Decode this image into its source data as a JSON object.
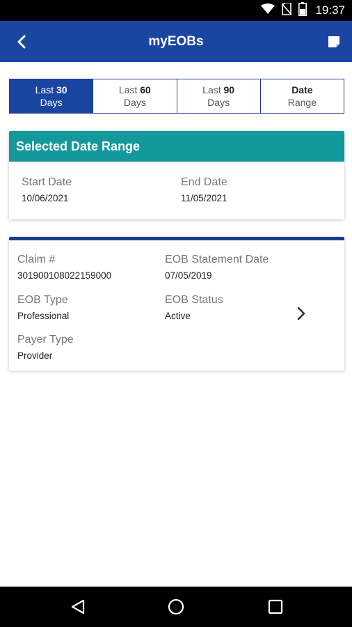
{
  "status_bar": {
    "time": "19:37",
    "icons": [
      "wifi-icon",
      "no-sim-icon",
      "battery-icon"
    ]
  },
  "app_bar": {
    "title": "myEOBs",
    "back_icon": "chevron-left-icon",
    "action_icon": "note-icon"
  },
  "date_tabs": [
    {
      "line1_prefix": "Last ",
      "line1_num": "30",
      "line2": "Days",
      "active": true
    },
    {
      "line1_prefix": "Last ",
      "line1_num": "60",
      "line2": "Days",
      "active": false
    },
    {
      "line1_prefix": "Last ",
      "line1_num": "90",
      "line2": "Days",
      "active": false
    },
    {
      "line1_prefix": "",
      "line1_num": "Date",
      "line2": "Range",
      "active": false
    }
  ],
  "selected_range": {
    "header": "Selected Date Range",
    "start_label": "Start Date",
    "start_value": "10/06/2021",
    "end_label": "End Date",
    "end_value": "11/05/2021"
  },
  "claim": {
    "claim_label": "Claim #",
    "claim_value": "301900108022159000",
    "statement_label": "EOB Statement Date",
    "statement_value": "07/05/2019",
    "type_label": "EOB Type",
    "type_value": "Professional",
    "status_label": "EOB Status",
    "status_value": "Active",
    "payer_label": "Payer Type",
    "payer_value": "Provider"
  },
  "nav": {
    "back_icon": "triangle-back-icon",
    "home_icon": "circle-home-icon",
    "recents_icon": "square-recents-icon"
  },
  "colors": {
    "primary": "#1a45a0",
    "teal": "#13989c",
    "dark_blue": "#1a3d8f"
  }
}
